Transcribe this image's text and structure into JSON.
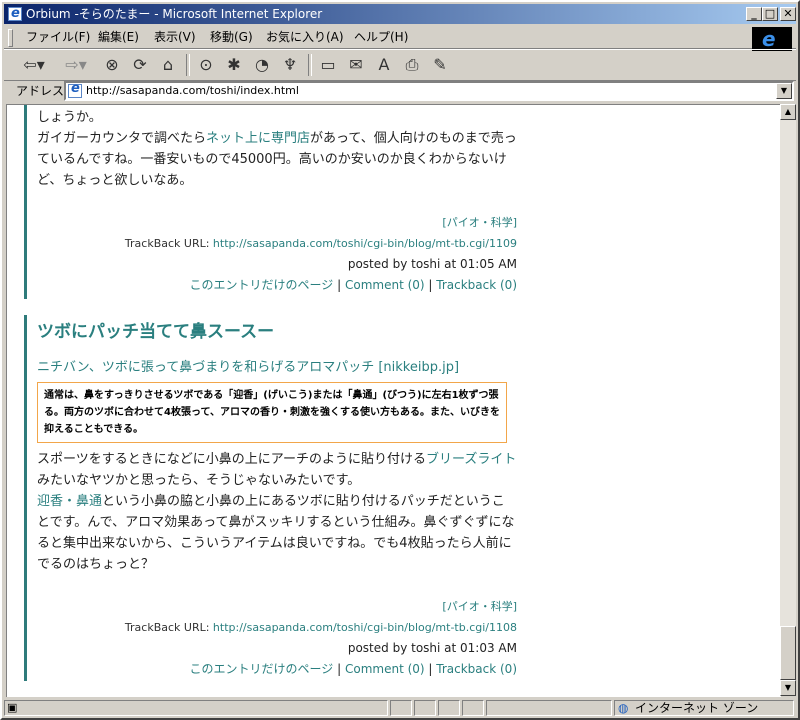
{
  "window": {
    "title": "Orbium -そらのたまー - Microsoft Internet Explorer",
    "minimize": "_",
    "maximize": "□",
    "close": "✕"
  },
  "menu": {
    "items": [
      "ファイル(F)",
      "編集(E)",
      "表示(V)",
      "移動(G)",
      "お気に入り(A)",
      "ヘルプ(H)"
    ]
  },
  "toolbar": {
    "icons": [
      "back-icon",
      "forward-icon",
      "stop-icon",
      "refresh-icon",
      "home-icon",
      "search-icon",
      "favorites-icon",
      "history-icon",
      "channels-icon",
      "fullscreen-icon",
      "mail-icon",
      "font-icon",
      "print-icon",
      "edit-icon"
    ]
  },
  "address": {
    "label": "アドレス",
    "url": "http://sasapanda.com/toshi/index.html"
  },
  "posts": {
    "p1": {
      "line0": "しょうか。",
      "text_a": "ガイガーカウンタで調べたら",
      "link_a": "ネット上に専門店",
      "text_b": "があって、個人向けのものまで売っているんですね。一番安いもので45000円。高いのか安いのか良くわからないけど、ちょっと欲しいなあ。",
      "category": "[パイオ・科学]",
      "trackback_label": "TrackBack URL: ",
      "trackback_url": "http://sasapanda.com/toshi/cgi-bin/blog/mt-tb.cgi/1109",
      "posted": "posted by toshi at 01:05 AM",
      "page_link": "このエントリだけのページ",
      "comment_link": "Comment (0)",
      "trackback_link": "Trackback (0)",
      "sep": " | "
    },
    "p2": {
      "title": "ツボにパッチ当てて鼻スースー",
      "source_link": "ニチバン、ツボに張って鼻づまりを和らげるアロマパッチ [nikkeibp.jp]",
      "quote": "通常は、鼻をすっきりさせるツボである「迎香」(げいこう)または「鼻通」(びつう)に左右1枚ずつ張る。両方のツボに合わせて4枚張って、アロマの香り・刺激を強くする使い方もある。また、いびきを抑えることもできる。",
      "text_a": "スポーツをするときになどに小鼻の上にアーチのように貼り付ける",
      "link_a": "ブリーズライト",
      "text_b": "みたいなヤツかと思ったら、そうじゃないみたいです。",
      "link_b": "迎香・鼻通",
      "text_c": "という小鼻の脇と小鼻の上にあるツボに貼り付けるパッチだということです。んで、アロマ効果あって鼻がスッキリするという仕組み。鼻ぐずぐずになると集中出来ないから、こういうアイテムは良いですね。でも4枚貼ったら人前にでるのはちょっと？",
      "category": "[パイオ・科学]",
      "trackback_label": "TrackBack URL: ",
      "trackback_url": "http://sasapanda.com/toshi/cgi-bin/blog/mt-tb.cgi/1108",
      "posted": "posted by toshi at 01:03 AM",
      "page_link": "このエントリだけのページ",
      "comment_link": "Comment (0)",
      "trackback_link": "Trackback (0)",
      "sep": " | "
    }
  },
  "status": {
    "zone": "インターネット ゾーン"
  },
  "colors": {
    "accent": "#2a7f7f",
    "titlebar": "#0a246a",
    "quote_border": "#f2a64a"
  }
}
